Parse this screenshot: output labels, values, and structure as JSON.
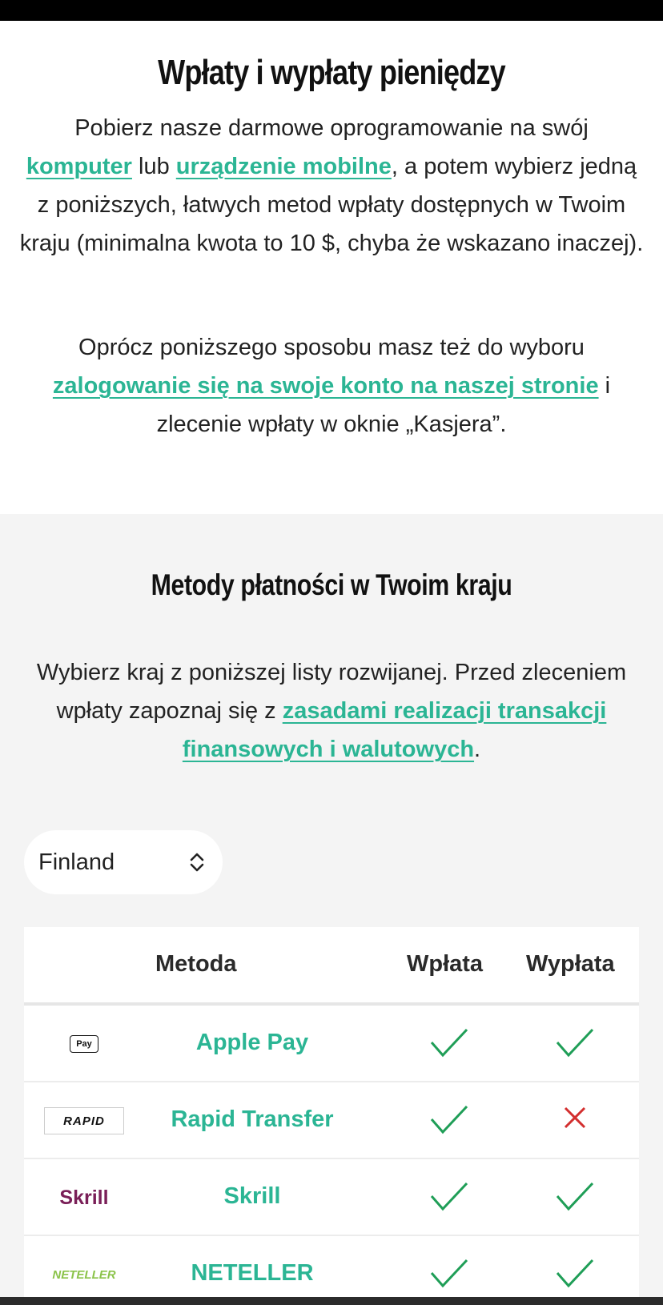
{
  "intro": {
    "title": "Wpłaty i wypłaty pieniędzy",
    "p1_a": "Pobierz nasze darmowe oprogramowanie na swój",
    "p1_link1": "komputer",
    "p1_b": " lub ",
    "p1_link2": "urządzenie mobilne",
    "p1_c": ", a potem wybierz jedną z poniższych, łatwych metod wpłaty dostępnych w Twoim kraju (minimalna kwota to 10 $, chyba że wskazano inaczej).",
    "p2_a": "Oprócz poniższego sposobu masz też do wyboru",
    "p2_link": "zalogowanie się na swoje konto na naszej stronie",
    "p2_b": " i zlecenie wpłaty w oknie „Kasjera”."
  },
  "methods": {
    "title": "Metody płatności w Twoim kraju",
    "p3_a": "Wybierz kraj z poniższej listy rozwijanej. Przed zleceniem wpłaty zapoznaj się z ",
    "p3_link": "zasadami realizacji transakcji finansowych i walutowych",
    "p3_b": ".",
    "country_select": "Finland",
    "table": {
      "headers": {
        "method": "Metoda",
        "deposit": "Wpłata",
        "withdrawal": "Wypłata"
      },
      "rows": [
        {
          "name": "Apple Pay",
          "logo_text": "Pay",
          "logo_icon": "apple-pay-logo",
          "deposit": true,
          "withdrawal": true
        },
        {
          "name": "Rapid Transfer",
          "logo_text": "RAPID",
          "logo_icon": "rapid-transfer-logo",
          "deposit": true,
          "withdrawal": false
        },
        {
          "name": "Skrill",
          "logo_text": "Skrill",
          "logo_icon": "skrill-logo",
          "deposit": true,
          "withdrawal": true
        },
        {
          "name": "NETELLER",
          "logo_text": "NETELLER",
          "logo_icon": "neteller-logo",
          "deposit": true,
          "withdrawal": true
        }
      ]
    }
  },
  "colors": {
    "link": "#2bb594",
    "check": "#1f9e57",
    "cross": "#d32f2f",
    "section_bg": "#f4f4f4"
  }
}
